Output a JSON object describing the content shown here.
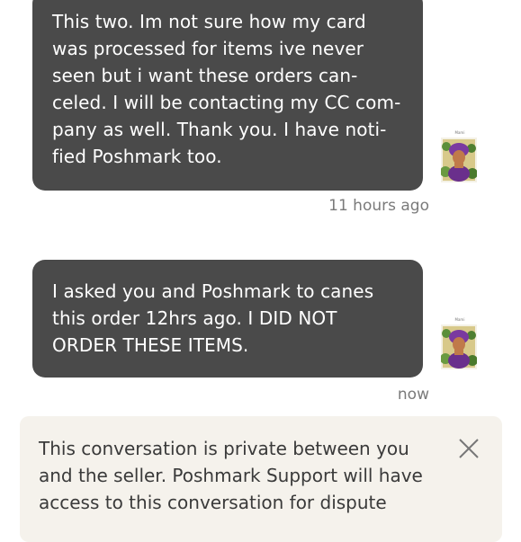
{
  "messages": [
    {
      "text": "This two. Im not sure how my card\nwas processed for items ive never\nseen but i want these orders can-\nceled. I will be contacting my CC com-\npany as well. Thank you. I have noti-\nfied Poshmark too.",
      "time": "11 hours ago",
      "avatar_label": "Mami",
      "avatar_icon": "profile-photo-icon"
    },
    {
      "text": "I asked you and Poshmark to canes\nthis order 12hrs ago. I DID NOT\nORDER THESE ITEMS.",
      "time": "now",
      "avatar_label": "Mami",
      "avatar_icon": "profile-photo-icon"
    }
  ],
  "notice": {
    "text": "This conversation is private between you\nand the seller. Poshmark Support will have\naccess to this conversation for dispute",
    "close_icon": "close-icon"
  },
  "colors": {
    "bubble": "#4a4a4a",
    "bubble_text": "#ffffff",
    "timestamp": "#7a7a7a",
    "notice_bg": "#f5f2ec",
    "notice_text": "#3a3a3a"
  }
}
